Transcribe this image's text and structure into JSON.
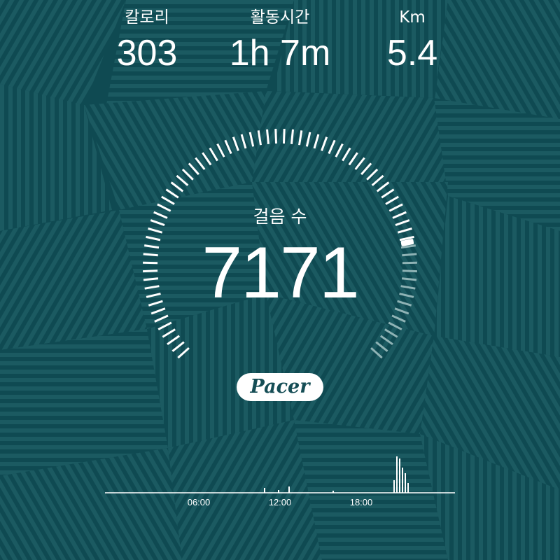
{
  "stats": {
    "calories": {
      "label": "칼로리",
      "value": "303"
    },
    "active_time": {
      "label": "활동시간",
      "value": "1h 7m"
    },
    "distance": {
      "label": "Km",
      "value": "5.4"
    }
  },
  "steps": {
    "label": "걸음 수",
    "value": "7171",
    "goal_progress": 0.8
  },
  "brand": {
    "name": "Pacer"
  },
  "timeline": {
    "ticks": [
      "06:00",
      "12:00",
      "18:00"
    ]
  },
  "colors": {
    "background": "#0f4a52",
    "stripe": "#1d5c63",
    "text": "#ffffff",
    "gauge_done": "#ffffff",
    "gauge_remaining": "#8fb3b5"
  }
}
